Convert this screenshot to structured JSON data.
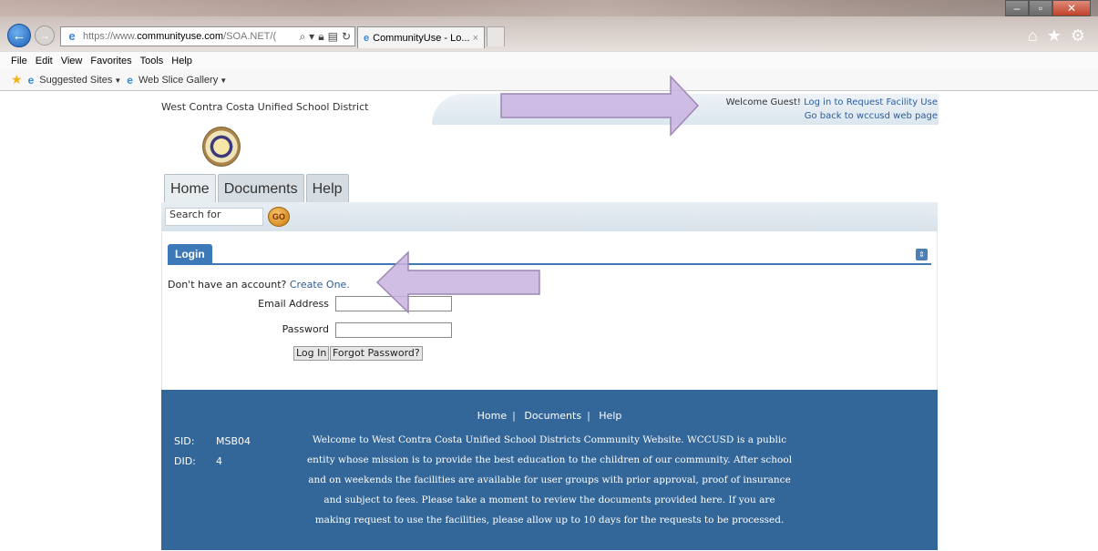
{
  "browser": {
    "url_prefix": "https://www.",
    "url_domain": "communityuse.com",
    "url_rest": "/SOA.NET/(",
    "tab_title": "CommunityUse - Lo...",
    "tab_close": "×",
    "menu": [
      "File",
      "Edit",
      "View",
      "Favorites",
      "Tools",
      "Help"
    ],
    "favorites": {
      "suggested_sites": "Suggested Sites",
      "web_slice_gallery": "Web Slice Gallery"
    }
  },
  "header": {
    "district_name": "West Contra Costa Unified School District",
    "welcome_text": "Welcome Guest!",
    "login_link": "Log in to Request Facility Use",
    "back_link": "Go back to wccusd web page"
  },
  "nav_tabs": [
    "Home",
    "Documents",
    "Help"
  ],
  "search": {
    "value": "Search for",
    "go_label": "GO"
  },
  "login": {
    "panel_title": "Login",
    "no_account_text": "Don't have an account?",
    "create_link": "Create One.",
    "email_label": "Email Address",
    "password_label": "Password",
    "login_button": "Log In",
    "forgot_button": "Forgot Password?"
  },
  "footer": {
    "links": [
      "Home",
      "Documents",
      "Help"
    ],
    "sid_label": "SID:",
    "sid_value": "MSB04",
    "did_label": "DID:",
    "did_value": "4",
    "welcome_lines": [
      "Welcome to West Contra Costa Unified School Districts Community Website. WCCUSD is a public",
      "entity whose mission is to provide the best education to the children of our community. After school",
      "and on weekends the facilities are available for user groups with prior approval, proof of insurance",
      "and subject to fees. Please take a moment to review the documents provided here. If you are",
      "making request to use the facilities, please allow up to 10 days for the requests to be processed."
    ]
  },
  "colors": {
    "footer_bg": "#336699",
    "link": "#2c5d9a",
    "login_tab": "#3d78b8",
    "annotation_arrow": "#c9b3e0"
  }
}
